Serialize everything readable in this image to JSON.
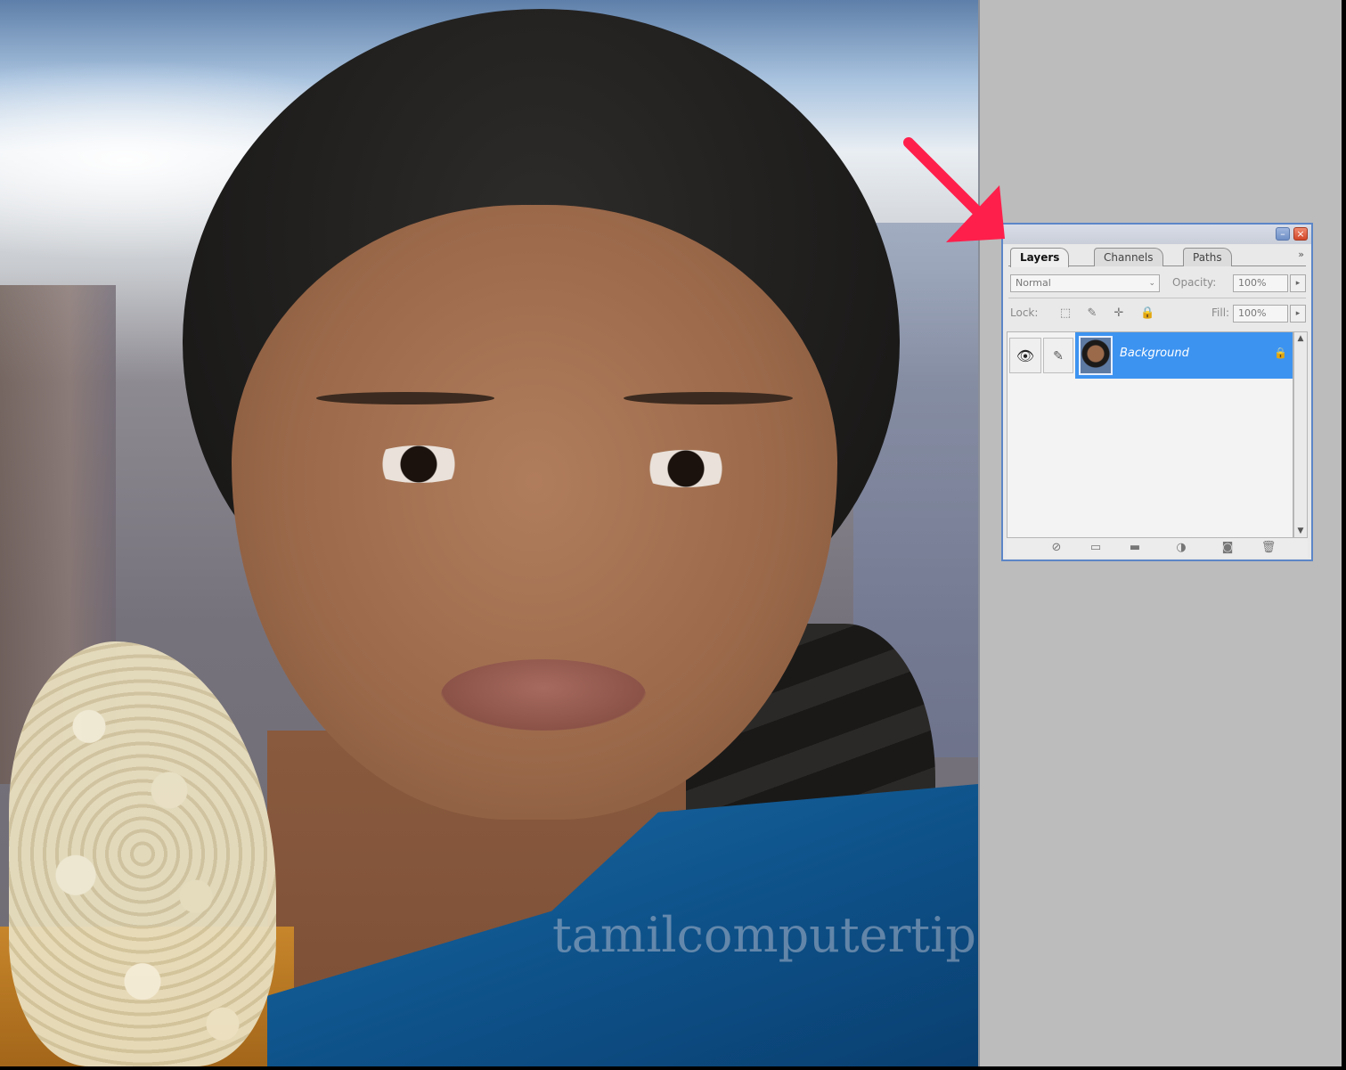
{
  "photo": {
    "watermark": "tamilcomputertips.blogspot.com"
  },
  "annotation": {
    "arrow_color": "#ff1f4b"
  },
  "palette": {
    "tabs": [
      {
        "label": "Layers",
        "active": true
      },
      {
        "label": "Channels",
        "active": false
      },
      {
        "label": "Paths",
        "active": false
      }
    ],
    "menu_icon": "»",
    "blend_mode": "Normal",
    "opacity_label": "Opacity:",
    "opacity_value": "100%",
    "lock_label": "Lock:",
    "fill_label": "Fill:",
    "fill_value": "100%",
    "layers": [
      {
        "name": "Background",
        "visible": true,
        "locked": true,
        "selected": true
      }
    ],
    "selection_color": "#3d93f0",
    "footer_icons": [
      "link-layers-icon",
      "layer-style-icon",
      "layer-mask-icon",
      "new-group-icon",
      "adjustment-layer-icon",
      "new-layer-icon",
      "delete-layer-icon"
    ]
  }
}
